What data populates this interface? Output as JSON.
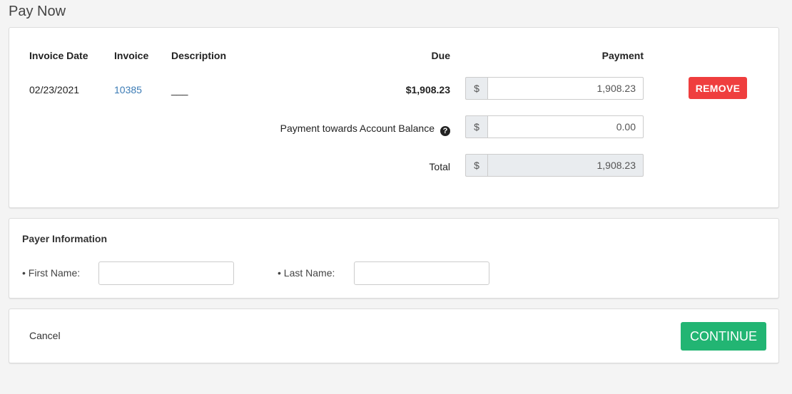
{
  "page": {
    "title": "Pay Now"
  },
  "table": {
    "headers": {
      "invoice_date": "Invoice Date",
      "invoice": "Invoice",
      "description": "Description",
      "due": "Due",
      "payment": "Payment"
    },
    "rows": [
      {
        "invoice_date": "02/23/2021",
        "invoice": "10385",
        "description": "___",
        "due": "$1,908.23",
        "currency": "$",
        "payment": "1,908.23",
        "remove_label": "REMOVE"
      }
    ],
    "account_balance": {
      "label": "Payment towards Account Balance",
      "help_icon": "?",
      "currency": "$",
      "value": "0.00"
    },
    "total": {
      "label": "Total",
      "currency": "$",
      "value": "1,908.23"
    }
  },
  "payer": {
    "title": "Payer Information",
    "first_name_label": "• First Name:",
    "first_name_value": "",
    "last_name_label": "• Last Name:",
    "last_name_value": ""
  },
  "actions": {
    "cancel_label": "Cancel",
    "continue_label": "CONTINUE"
  },
  "colors": {
    "remove": "#ef3e3e",
    "continue": "#22b573",
    "link": "#3b7bb5"
  }
}
